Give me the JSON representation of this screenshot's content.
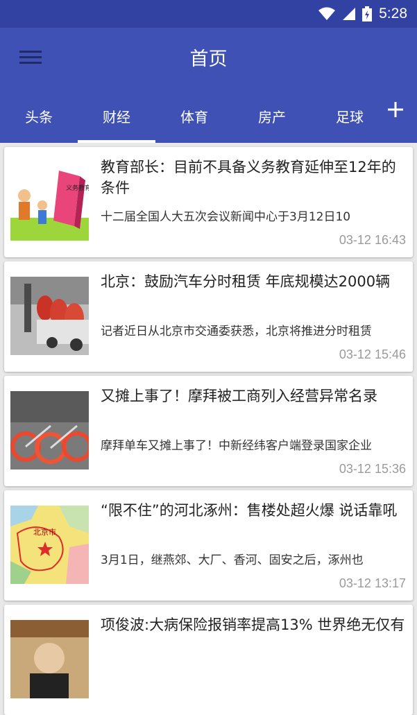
{
  "status": {
    "time": "5:28"
  },
  "appbar": {
    "title": "首页"
  },
  "tabs": [
    {
      "label": "头条"
    },
    {
      "label": "财经"
    },
    {
      "label": "体育"
    },
    {
      "label": "房产"
    },
    {
      "label": "足球"
    }
  ],
  "active_tab": "财经",
  "news": [
    {
      "title": "教育部长：目前不具备义务教育延伸至12年的条件",
      "summary": "十二届全国人大五次会议新闻中心于3月12日10",
      "time": "03-12 16:43",
      "thumb_text": "义务教育"
    },
    {
      "title": "北京：鼓励汽车分时租赁 年底规模达2000辆",
      "summary": "记者近日从北京市交通委获悉，北京将推进分时租赁",
      "time": "03-12 15:46"
    },
    {
      "title": "又摊上事了！摩拜被工商列入经营异常名录",
      "summary": "摩拜单车又摊上事了！中新经纬客户端登录国家企业",
      "time": "03-12 15:36"
    },
    {
      "title": "“限不住”的河北涿州：售楼处超火爆 说话靠吼",
      "summary": "3月1日，继燕郊、大厂、香河、固安之后，涿州也",
      "time": "03-12 13:17",
      "thumb_text": "北京市"
    },
    {
      "title": "项俊波:大病保险报销率提高13% 世界绝无仅有",
      "summary": "",
      "time": ""
    }
  ]
}
